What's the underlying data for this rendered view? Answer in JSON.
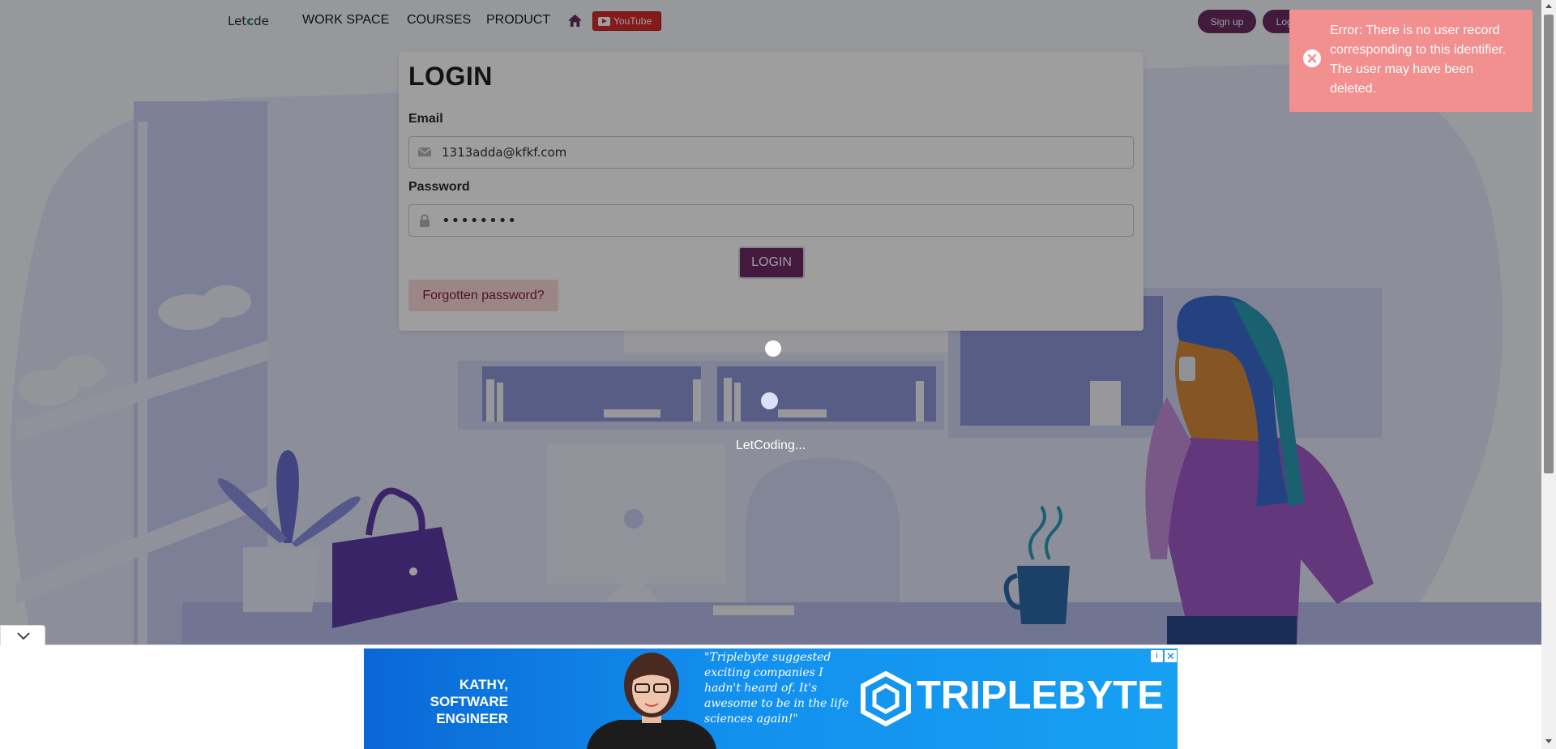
{
  "navbar": {
    "logo_prefix": "Let",
    "logo_o": "c",
    "logo_suffix": "de",
    "links": [
      "WORK SPACE",
      "COURSES",
      "PRODUCT"
    ],
    "home_icon": "home-icon",
    "youtube_label": "YouTube",
    "signup_label": "Sign up",
    "login_label": "Log in"
  },
  "login_form": {
    "title": "LOGIN",
    "email_label": "Email",
    "email_value": "1313adda@kfkf.com",
    "password_label": "Password",
    "password_value": "••••••••",
    "submit_label": "LOGIN",
    "forgot_label": "Forgotten password?"
  },
  "loader": {
    "text": "LetCoding..."
  },
  "toast": {
    "message": "Error: There is no user record corresponding to this identifier. The user may have been deleted.",
    "icon": "close-circle-icon",
    "color": "#f28f8f"
  },
  "ad": {
    "name_line": "KATHY, SOFTWARE ENGINEER",
    "quote": "\"Triplebyte suggested exciting companies I hadn't heard of. It's awesome to be in the life sciences again!\"",
    "brand": "TRIPLEBYTE",
    "choices_icon": "adchoices-icon",
    "close_icon": "close-icon"
  },
  "colors": {
    "brand": "#6d2a63",
    "youtube": "#d62b2b",
    "overlay": "rgba(0,0,0,0.38)"
  }
}
